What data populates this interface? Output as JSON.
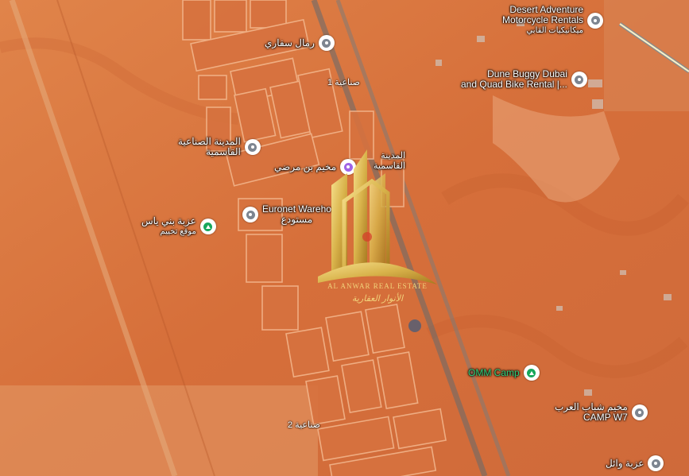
{
  "map": {
    "colors": {
      "sand": "#d9733f",
      "sand_light": "#e69a66",
      "pin_gray": "#7d8590",
      "pin_green": "#17a75a",
      "pin_purple": "#a064e6",
      "label_green": "#2fd07b",
      "gold": "#d8b24a"
    },
    "roads": [
      {
        "label": "صناعية 1"
      },
      {
        "label": "صناعية 2"
      }
    ]
  },
  "pois": [
    {
      "label_lines": [
        "Desert Adventure",
        "Motorcycle Rentals",
        "ميكانيكيات القابي"
      ],
      "icon": "pin-icon",
      "style": "gray"
    },
    {
      "label_lines": [
        "رمال سفاري"
      ],
      "icon": "pin-icon",
      "style": "gray"
    },
    {
      "label_lines": [
        "Dune Buggy Dubai",
        "and Quad Bike Rental |..."
      ],
      "icon": "pin-icon",
      "style": "gray"
    },
    {
      "label_lines": [
        "المدينة الصناعية",
        "القاسمية"
      ],
      "icon": "pin-icon",
      "style": "gray"
    },
    {
      "label_lines": [
        "مخيم بن مرضي"
      ],
      "icon": "camera-icon",
      "style": "purple"
    },
    {
      "label_lines": [
        "المدينة",
        "القاسمية"
      ],
      "icon": "none",
      "style": "plain"
    },
    {
      "label_lines": [
        "Euronet Wareho",
        "مستودع"
      ],
      "icon": "pin-icon",
      "style": "gray"
    },
    {
      "label_lines": [
        "عزبة بني ياس",
        "موقع تخييم"
      ],
      "icon": "campsite-icon",
      "style": "green"
    },
    {
      "label_lines": [
        "OMM Camp"
      ],
      "icon": "campsite-icon",
      "style": "green"
    },
    {
      "label_lines": [
        "مخيم شباب العرب",
        "CAMP W7"
      ],
      "icon": "pin-icon",
      "style": "gray"
    },
    {
      "label_lines": [
        "عزبة وائل"
      ],
      "icon": "pin-icon",
      "style": "gray"
    }
  ],
  "logo": {
    "text_en": "AL ANWAR REAL ESTATE",
    "text_ar": "الأنوار العقارية",
    "color": "#d8b24a"
  }
}
